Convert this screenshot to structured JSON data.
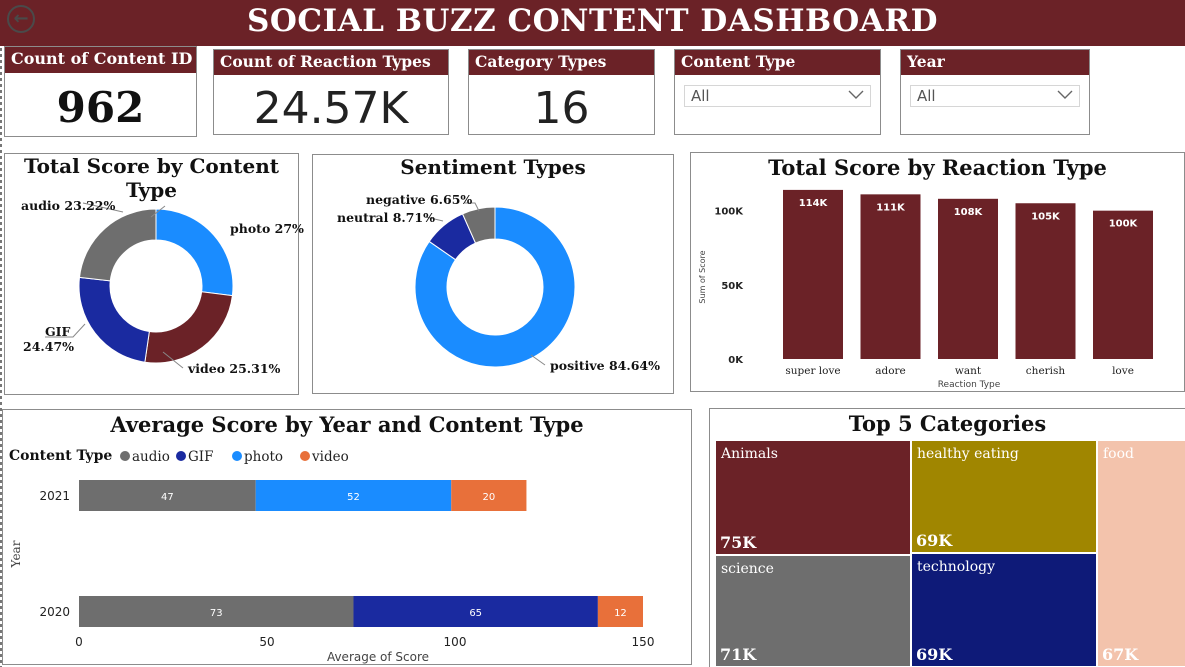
{
  "title": "SOCIAL BUZZ CONTENT DASHBOARD",
  "kpis": [
    {
      "label": "Count of Content ID",
      "value": "962"
    },
    {
      "label": "Count of Reaction Types",
      "value": "24.57K"
    },
    {
      "label": "Category Types",
      "value": "16"
    }
  ],
  "slicers": [
    {
      "label": "Content Type",
      "value": "All"
    },
    {
      "label": "Year",
      "value": "All"
    }
  ],
  "colors": {
    "maroon": "#6b2227",
    "grey": "#6e6e6e",
    "navy": "#1a2aa0",
    "blue": "#1a8cff",
    "orange": "#e8703a",
    "olive": "#a08600",
    "peach": "#f3c3ac"
  },
  "chart_data": [
    {
      "type": "pie",
      "title": "Total Score by Content Type",
      "slices": [
        {
          "label": "photo",
          "pct": 27.0,
          "display": "photo 27%",
          "color": "#1a8cff"
        },
        {
          "label": "video",
          "pct": 25.31,
          "display": "video 25.31%",
          "color": "#6b2227"
        },
        {
          "label": "GIF",
          "pct": 24.47,
          "display_line1": "GIF",
          "display_line2": "24.47%",
          "color": "#1a2aa0"
        },
        {
          "label": "audio",
          "pct": 23.22,
          "display": "audio 23.22%",
          "color": "#6e6e6e"
        }
      ]
    },
    {
      "type": "pie",
      "title": "Sentiment Types",
      "slices": [
        {
          "label": "positive",
          "pct": 84.64,
          "display": "positive 84.64%",
          "color": "#1a8cff"
        },
        {
          "label": "neutral",
          "pct": 8.71,
          "display": "neutral 8.71%",
          "color": "#1a2aa0"
        },
        {
          "label": "negative",
          "pct": 6.65,
          "display": "negative 6.65%",
          "color": "#6e6e6e"
        }
      ]
    },
    {
      "type": "bar",
      "title": "Total Score by Reaction Type",
      "xlabel": "Reaction Type",
      "ylabel": "Sum of Score",
      "categories": [
        "super love",
        "adore",
        "want",
        "cherish",
        "love"
      ],
      "values": [
        114,
        111,
        108,
        105,
        100
      ],
      "data_labels": [
        "114K",
        "111K",
        "108K",
        "105K",
        "100K"
      ],
      "yticks": [
        {
          "v": 0,
          "label": "0K"
        },
        {
          "v": 50,
          "label": "50K"
        },
        {
          "v": 100,
          "label": "100K"
        }
      ],
      "ylim": [
        0,
        120
      ],
      "color": "#6b2227"
    },
    {
      "type": "bar",
      "orientation": "horizontal",
      "stacked": true,
      "title": "Average Score by Year and Content Type",
      "xlabel": "Average of Score",
      "ylabel": "Year",
      "legend_title": "Content Type",
      "legend": [
        {
          "name": "audio",
          "color": "#6e6e6e"
        },
        {
          "name": "GIF",
          "color": "#1a2aa0"
        },
        {
          "name": "photo",
          "color": "#1a8cff"
        },
        {
          "name": "video",
          "color": "#e8703a"
        }
      ],
      "xticks": [
        "0",
        "50",
        "100",
        "150"
      ],
      "xlim": [
        0,
        150
      ],
      "rows": [
        {
          "year": "2021",
          "segments": [
            {
              "series": "audio",
              "value": 47
            },
            {
              "series": "photo",
              "value": 52
            },
            {
              "series": "video",
              "value": 20
            }
          ]
        },
        {
          "year": "2020",
          "segments": [
            {
              "series": "audio",
              "value": 73
            },
            {
              "series": "GIF",
              "value": 65
            },
            {
              "series": "video",
              "value": 12
            }
          ]
        }
      ]
    },
    {
      "type": "treemap",
      "title": "Top 5 Categories",
      "items": [
        {
          "name": "Animals",
          "value": "75K",
          "color": "#6b2227"
        },
        {
          "name": "science",
          "value": "71K",
          "color": "#6e6e6e"
        },
        {
          "name": "healthy eating",
          "value": "69K",
          "color": "#a08600"
        },
        {
          "name": "technology",
          "value": "69K",
          "color": "#0e1a78"
        },
        {
          "name": "food",
          "value": "67K",
          "color": "#f3c3ac"
        }
      ]
    }
  ]
}
